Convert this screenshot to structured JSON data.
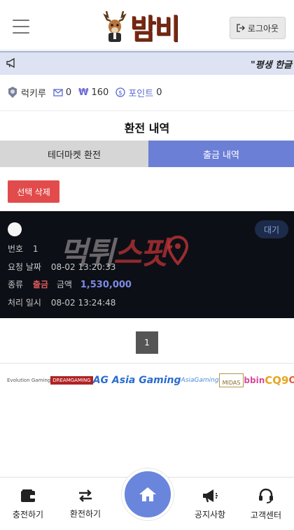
{
  "header": {
    "logo_text": "밤비",
    "logout_label": "로그아웃"
  },
  "notice": {
    "text": "\"평생 한글 도메인"
  },
  "user": {
    "name": "럭키루",
    "messages": "0",
    "balance_symbol": "₩",
    "balance": "160",
    "points_label": "포인트",
    "points": "0"
  },
  "page": {
    "title": "환전 내역"
  },
  "tabs": [
    {
      "label": "테더마켓 환전",
      "active": false
    },
    {
      "label": "출금 내역",
      "active": true
    }
  ],
  "actions": {
    "delete_selected": "선택 삭제"
  },
  "record": {
    "status": "대기",
    "number_label": "번호",
    "number": "1",
    "request_date_label": "요청 날짜",
    "request_date": "08-02 13:20:33",
    "type_label": "종류",
    "type_value": "출금",
    "amount_label": "금액",
    "amount": "1,530,000",
    "processed_label": "처리 일시",
    "processed_date": "08-02 13:24:48",
    "watermark_a": "먹튀",
    "watermark_b": "스팟"
  },
  "pagination": {
    "current_page": "1"
  },
  "partners": [
    "Evolution Gaming",
    "DREAMGAMING",
    "AG Asia Gaming",
    "AsiaGaming",
    "MIDAS",
    "bbin",
    "CQ9",
    "OG"
  ],
  "bottom_nav": {
    "charge": "충전하기",
    "exchange": "환전하기",
    "notice": "공지사항",
    "support": "고객센터"
  },
  "colors": {
    "accent": "#6c7fd6",
    "danger": "#e24b4b",
    "card_bg": "#0d0f16",
    "amount": "#7d8be6",
    "withdraw": "#e05a5a"
  }
}
